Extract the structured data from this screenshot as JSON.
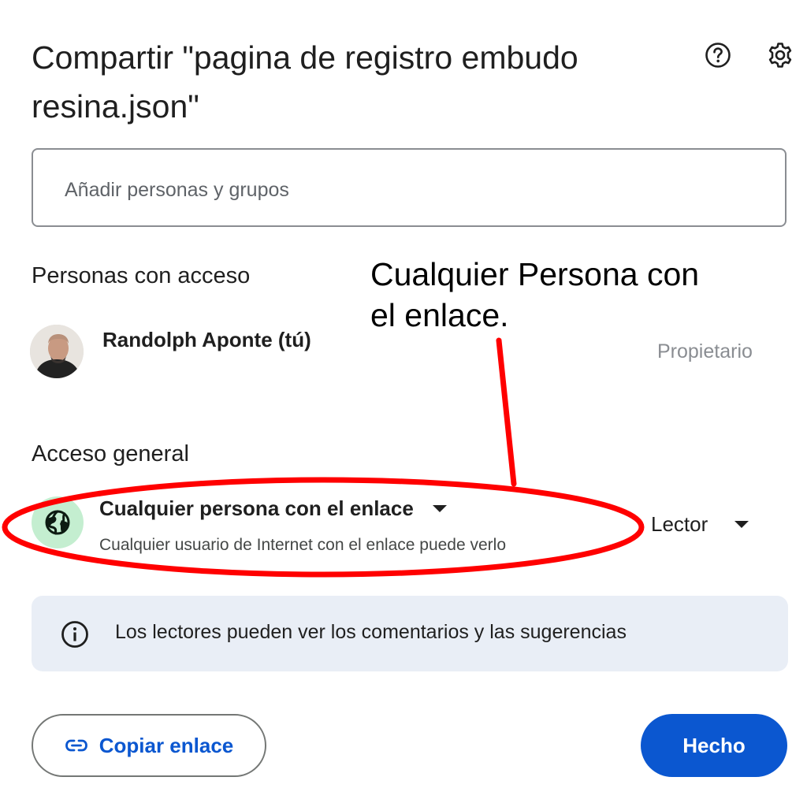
{
  "dialog": {
    "title": "Compartir \"pagina de registro embudo resina.json\"",
    "help_icon": "help-circle-icon",
    "settings_icon": "gear-icon"
  },
  "add_people": {
    "placeholder": "Añadir personas y grupos",
    "value": ""
  },
  "people_section": {
    "title": "Personas con acceso",
    "people": [
      {
        "name": "Randolph Aponte (tú)",
        "role": "Propietario",
        "avatar": "avatar-photo"
      }
    ]
  },
  "general_access": {
    "title": "Acceso general",
    "icon": "globe-icon",
    "selected_option": "Cualquier persona con el enlace",
    "description": "Cualquier usuario de Internet con el enlace puede verlo",
    "role": "Lector"
  },
  "info_banner": {
    "icon": "info-icon",
    "text": "Los lectores pueden ver los comentarios y las sugerencias"
  },
  "footer": {
    "copy_link_label": "Copiar enlace",
    "copy_link_icon": "link-icon",
    "done_label": "Hecho"
  },
  "annotation": {
    "text": "Cualquier Persona con el enlace.",
    "color": "#ff0000"
  },
  "colors": {
    "accent": "#0b57d0",
    "globe_bg": "#c4eed0",
    "info_bg": "#e9eef6"
  }
}
